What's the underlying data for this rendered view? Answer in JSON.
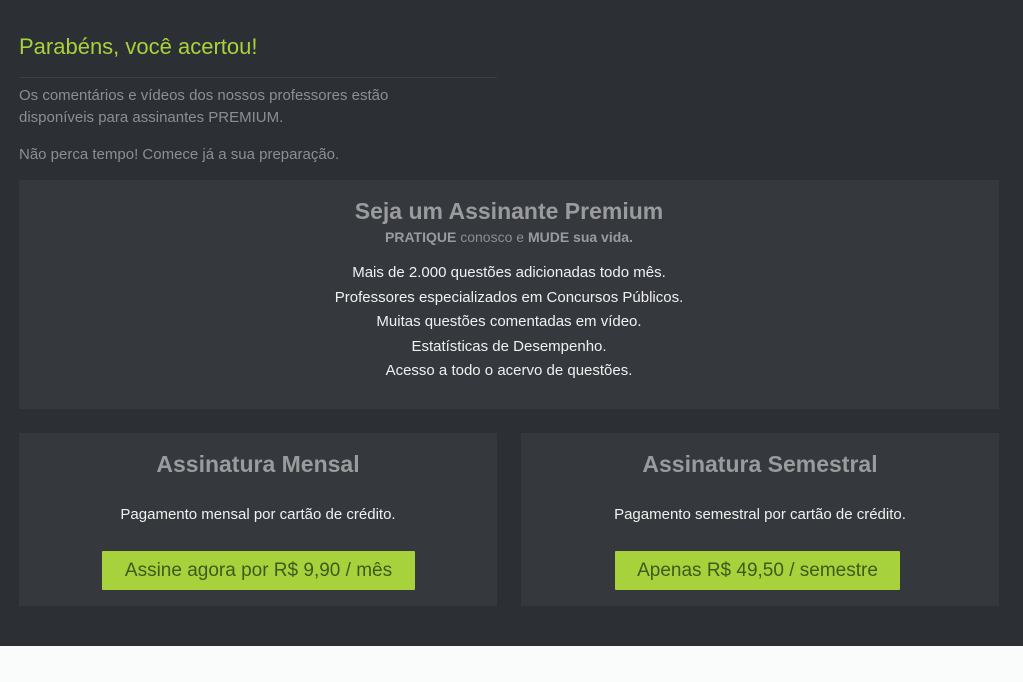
{
  "result": {
    "title": "Parabéns, você acertou!",
    "info_line1": "Os comentários e vídeos dos nossos professores estão",
    "info_line2": "disponíveis para assinantes PREMIUM.",
    "hurry": "Não perca tempo! Comece já a sua preparação."
  },
  "premium": {
    "title": "Seja um Assinante Premium",
    "tagline_word1": "PRATIQUE",
    "tagline_mid": " conosco e ",
    "tagline_word2": "MUDE sua vida.",
    "benefits": [
      "Mais de 2.000 questões adicionadas todo mês.",
      "Professores especializados em Concursos Públicos.",
      "Muitas questões comentadas em vídeo.",
      "Estatísticas de Desempenho.",
      "Acesso a todo o acervo de questões."
    ]
  },
  "plans": [
    {
      "title": "Assinatura Mensal",
      "description": "Pagamento mensal por cartão de crédito.",
      "button": "Assine agora por R$ 9,90 / mês"
    },
    {
      "title": "Assinatura Semestral",
      "description": "Pagamento semestral por cartão de crédito.",
      "button": "Apenas R$ 49,50 / semestre"
    }
  ],
  "colors": {
    "accent": "#a8d23c",
    "panel": "#2c2f33",
    "card": "#35383d"
  }
}
